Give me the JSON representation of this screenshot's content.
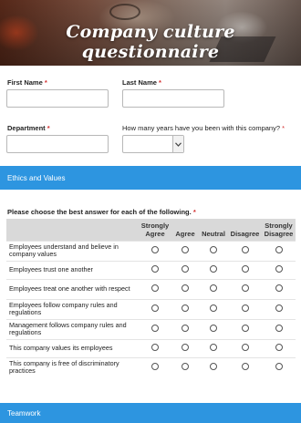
{
  "header": {
    "title": "Company culture questionnaire"
  },
  "form": {
    "first_name": {
      "label": "First Name",
      "required_mark": "*",
      "value": ""
    },
    "last_name": {
      "label": "Last Name",
      "required_mark": "*",
      "value": ""
    },
    "department": {
      "label": "Department",
      "required_mark": "*",
      "value": ""
    },
    "years": {
      "label": "How many years have you been with this company?",
      "required_mark": "*",
      "selected": ""
    }
  },
  "sections": {
    "ethics": "Ethics and Values",
    "teamwork": "Teamwork"
  },
  "matrix": {
    "instruction": "Please choose the best answer for each of the following.",
    "required_mark": "*",
    "columns": [
      {
        "top": "Strongly",
        "bottom": "Agree"
      },
      {
        "top": "",
        "bottom": "Agree"
      },
      {
        "top": "",
        "bottom": "Neutral"
      },
      {
        "top": "",
        "bottom": "Disagree"
      },
      {
        "top": "Strongly",
        "bottom": "Disagree"
      }
    ],
    "rows": [
      {
        "label": "Employees understand and believe in company values"
      },
      {
        "label": "Employees trust one another"
      },
      {
        "label": "Employees treat one another with respect"
      },
      {
        "label": "Employees follow company rules and regulations"
      },
      {
        "label": "Management follows company rules and regulations"
      },
      {
        "label": "This company values its employees"
      },
      {
        "label": "This company is free of discriminatory practices"
      }
    ]
  },
  "colors": {
    "section_bar": "#2d95e0",
    "required": "#d32f2f",
    "matrix_header": "#d9d9d9"
  }
}
